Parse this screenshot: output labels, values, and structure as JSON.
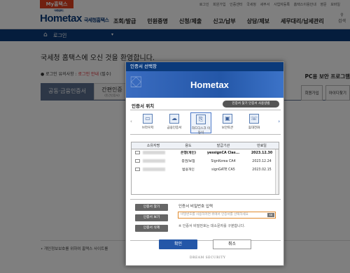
{
  "top": {
    "my_tab": "My홈택스",
    "links": [
      "로그인",
      "회원가입",
      "인증센터",
      "국세청",
      "세무서",
      "사업자등록",
      "홈택스이용안내",
      "영문",
      "모바일"
    ]
  },
  "header": {
    "logo": "Hometax",
    "logo_sub": "국세청홈택스",
    "logo_small": "국세청 홈택스",
    "nav": [
      "조회/발급",
      "민원증명",
      "신청/제출",
      "신고/납부",
      "상담/제보",
      "세무대리/납세관리"
    ],
    "right_icon": "검색"
  },
  "breadcrumb": {
    "home": "⌂",
    "label": "로그인",
    "caret": "▾"
  },
  "page": {
    "welcome": "국세청 홈택스에 오신 것을 환영합니다.",
    "notice_prefix": "● 로그인 유의사항 : ",
    "notice_red": "로그인 안내",
    "notice_suffix": " (필수)",
    "pc_security": "PC용 보안 프로그램",
    "tab_cert": "공동·금융인증서",
    "tab_simple": "간편인증",
    "tab_simple_sub": "(민간인증서)",
    "right_buttons": [
      "회원가입",
      "아이디찾기"
    ],
    "footnote": "• 개인정보보호를 위하여 홈택스 사이트를"
  },
  "dialog": {
    "title": "인증서 선택창",
    "banner_logo": "Hometax",
    "location_title": "인증서 위치",
    "help_button": "인증서 찾기 인증서 사용방법",
    "locations": [
      {
        "label": "브라우저",
        "icon": "browser-icon"
      },
      {
        "label": "금융인증서",
        "icon": "cloud-icon"
      },
      {
        "label": "하드디스크 이동식",
        "icon": "usb-icon"
      },
      {
        "label": "보안토큰",
        "icon": "token-icon"
      },
      {
        "label": "휴대전화",
        "icon": "phone-icon"
      }
    ],
    "table_headers": [
      "소유자명",
      "용도",
      "발급기관",
      "만료일"
    ],
    "table_rows": [
      {
        "purpose": "은행(개인)",
        "issuer": "yessignCA Clas...",
        "expiry": "2023.12.30",
        "selected": true
      },
      {
        "purpose": "증권/보험",
        "issuer": "SignKorea CA4",
        "expiry": "2023.12.24",
        "selected": false
      },
      {
        "purpose": "범용개인",
        "issuer": "signGATE CA5",
        "expiry": "2023.02.15",
        "selected": false
      }
    ],
    "side_buttons": [
      "인증서 찾기",
      "인증서 보기",
      "인증서 삭제"
    ],
    "password_label": "인증서 비밀번호 입력",
    "password_placeholder": "비밀번호를 사용하려면 위에서 인증서를 선택하세요",
    "keyboard_label": "KB",
    "password_notice": "※ 인증서 비밀번호는 대소문자를 구분합니다.",
    "ok_label": "확인",
    "cancel_label": "취소",
    "footer_brand": "DREAM SECURITY"
  }
}
